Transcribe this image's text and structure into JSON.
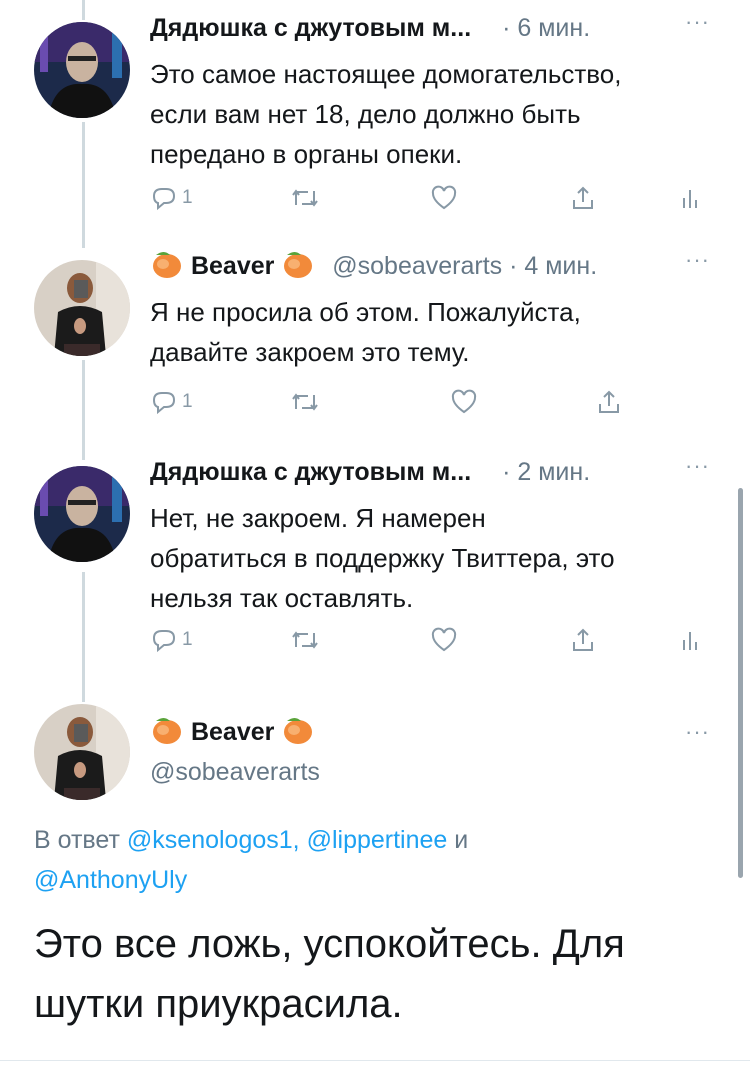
{
  "colors": {
    "text": "#14171a",
    "muted": "#657786",
    "link": "#1da1f2",
    "thread": "#cfd9de"
  },
  "tweets": [
    {
      "name": "Дядюшка с джутовым м...",
      "time": "· 6 мин.",
      "more": "···",
      "lines": [
        "Это самое настоящее домогательство,",
        "если вам нет 18, дело должно быть",
        "передано в органы опеки."
      ],
      "reply_count": "1"
    },
    {
      "name": "Beaver",
      "handle": "@sobeaverarts",
      "time": "· 4 мин.",
      "more": "···",
      "lines": [
        "Я не просила об этом. Пожалуйста,",
        "давайте закроем это тему."
      ],
      "reply_count": "1"
    },
    {
      "name": "Дядюшка с джутовым м...",
      "time": "· 2 мин.",
      "more": "···",
      "lines": [
        "Нет, не закроем. Я намерен",
        "обратиться в поддержку Твиттера, это",
        "нельзя так оставлять."
      ],
      "reply_count": "1"
    }
  ],
  "main": {
    "name": "Beaver",
    "handle": "@sobeaverarts",
    "more": "···",
    "reply_prefix": "В ответ",
    "mention1": "@ksenologos1,",
    "mention2": "@lippertinee",
    "and": "и",
    "mention3": "@AnthonyUly",
    "lines": [
      "Это все ложь, успокойтесь. Для",
      "шутки приукрасила."
    ]
  },
  "icons": [
    "reply-icon",
    "retweet-icon",
    "like-icon",
    "share-icon",
    "analytics-icon",
    "peach-emoji-icon",
    "more-icon"
  ]
}
